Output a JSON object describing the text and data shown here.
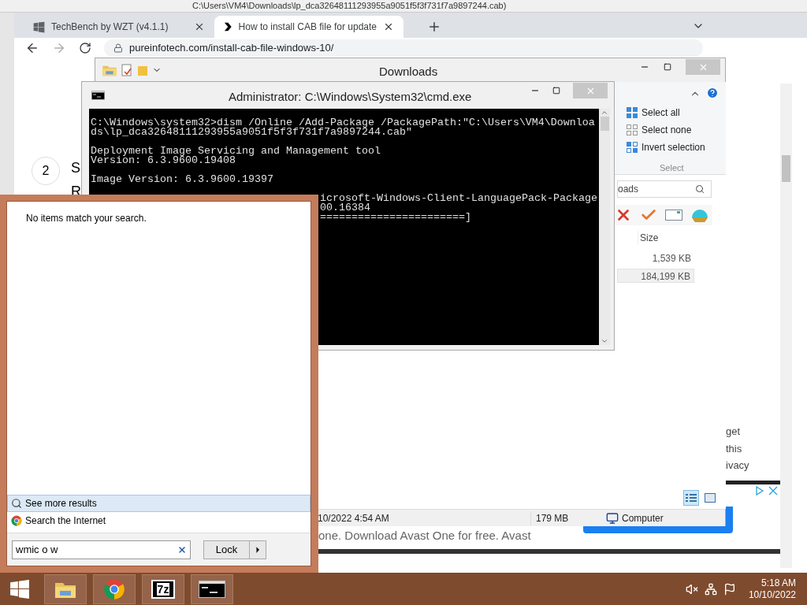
{
  "background_window": {
    "title": "C:\\Users\\VM4\\Downloads\\lp_dca32648111293955a9051f5f3f731f7a9897244.cab)"
  },
  "browser": {
    "tabs": [
      {
        "label": "TechBench by WZT (v4.1.1)",
        "selected": false
      },
      {
        "label": "How to install CAB file for update",
        "selected": true
      }
    ],
    "url": "pureinfotech.com/install-cab-file-windows-10/",
    "page": {
      "step_number": "2",
      "heading_fragment": "S",
      "line_fragment": "R",
      "side_lines": [
        "get",
        "this",
        "ivacy"
      ],
      "ad_text": "one. Download Avast One for free. Avast"
    }
  },
  "explorer": {
    "title": "Downloads",
    "select_items": [
      {
        "label": "Select all",
        "kind": "all"
      },
      {
        "label": "Select none",
        "kind": "none"
      },
      {
        "label": "Invert selection",
        "kind": "invert"
      }
    ],
    "select_group": "Select",
    "search": {
      "value": "oads"
    },
    "columns": [
      "Size"
    ],
    "rows": [
      {
        "size": "1,539 KB",
        "selected": false
      },
      {
        "size": "184,199 KB",
        "selected": true
      }
    ],
    "views": [
      {
        "kind": "details",
        "selected": true
      },
      {
        "kind": "preview",
        "selected": false
      }
    ],
    "status": {
      "date": "10/2022 4:54 AM",
      "size": "179 MB",
      "location": "Computer"
    }
  },
  "console": {
    "title": "Administrator: C:\\Windows\\System32\\cmd.exe",
    "lines": [
      {
        "kind": "full",
        "text": "C:\\Windows\\system32>dism /Online /Add-Package /PackagePath:\"C:\\Users\\VM4\\Downloa"
      },
      {
        "kind": "full",
        "text": "ds\\lp_dca32648111293955a9051f5f3f731f7a9897244.cab\""
      },
      {
        "kind": "blank"
      },
      {
        "kind": "full",
        "text": "Deployment Image Servicing and Management tool"
      },
      {
        "kind": "full",
        "text": "Version: 6.3.9600.19408"
      },
      {
        "kind": "blank"
      },
      {
        "kind": "full",
        "text": "Image Version: 6.3.9600.19397"
      },
      {
        "kind": "blank"
      },
      {
        "kind": "partial",
        "text": "icrosoft-Windows-Client-LanguagePack-Package"
      },
      {
        "kind": "partial",
        "text": "00.16384"
      },
      {
        "kind": "partial",
        "text": "=======================]"
      }
    ]
  },
  "search_pane": {
    "message": "No items match your search.",
    "links": [
      {
        "label": "See more results",
        "kind": "search",
        "selected": true
      },
      {
        "label": "Search the Internet",
        "kind": "web",
        "selected": false
      }
    ],
    "query": "wmic o w",
    "power_button": "Lock"
  },
  "taskbar": {
    "apps": [
      {
        "kind": "explorer"
      },
      {
        "kind": "chrome"
      },
      {
        "kind": "archiver",
        "label": "7z"
      },
      {
        "kind": "console"
      }
    ],
    "time": "5:18 AM",
    "date": "10/10/2022"
  }
}
